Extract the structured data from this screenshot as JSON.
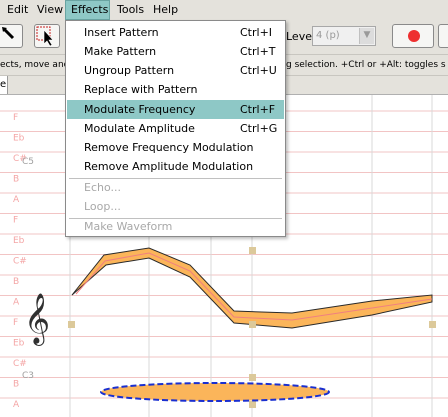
{
  "menubar": {
    "items": [
      {
        "label": "Edit"
      },
      {
        "label": "View"
      },
      {
        "label": "Effects"
      },
      {
        "label": "Tools"
      },
      {
        "label": "Help"
      }
    ]
  },
  "toolbar": {
    "level_label": "Level:",
    "level_value": "4 (p)"
  },
  "status": {
    "left_text": "ects, move and",
    "right_text": "g selection. +Ctrl or +Alt: toggles s"
  },
  "tab": {
    "label": "e"
  },
  "effects_menu": {
    "items": [
      {
        "label": "Insert Pattern",
        "shortcut": "Ctrl+I",
        "enabled": true
      },
      {
        "label": "Make Pattern",
        "shortcut": "Ctrl+T",
        "enabled": true
      },
      {
        "label": "Ungroup Pattern",
        "shortcut": "Ctrl+U",
        "enabled": true
      },
      {
        "label": "Replace with Pattern",
        "shortcut": "",
        "enabled": true
      },
      {
        "label": "Modulate Frequency",
        "shortcut": "Ctrl+F",
        "enabled": true,
        "highlighted": true
      },
      {
        "label": "Modulate Amplitude",
        "shortcut": "Ctrl+G",
        "enabled": true
      },
      {
        "label": "Remove Frequency Modulation",
        "shortcut": "",
        "enabled": true
      },
      {
        "label": "Remove Amplitude Modulation",
        "shortcut": "",
        "enabled": true
      },
      {
        "label": "Echo...",
        "shortcut": "",
        "enabled": false
      },
      {
        "label": "Loop...",
        "shortcut": "",
        "enabled": false
      },
      {
        "label": "Make Waveform",
        "shortcut": "",
        "enabled": false
      }
    ]
  },
  "staff": {
    "note_labels": [
      "F",
      "Eb",
      "C#",
      "B",
      "A",
      "F",
      "Eb",
      "C#",
      "B",
      "A",
      "F",
      "Eb",
      "C#",
      "B",
      "A"
    ],
    "octave_labels": [
      "C5",
      "C3"
    ]
  },
  "colors": {
    "menu_highlight": "#8ec8c6",
    "shape_fill": "#fbb55a",
    "shape_outline": "#2a2a2a",
    "selection_dash": "#1a2fd0",
    "staff_line": "#f2c4c4",
    "handle": "#dcc99a"
  },
  "icons": [
    "pencil-tool-icon",
    "select-tool-icon",
    "record-icon",
    "treble-clef-icon"
  ]
}
